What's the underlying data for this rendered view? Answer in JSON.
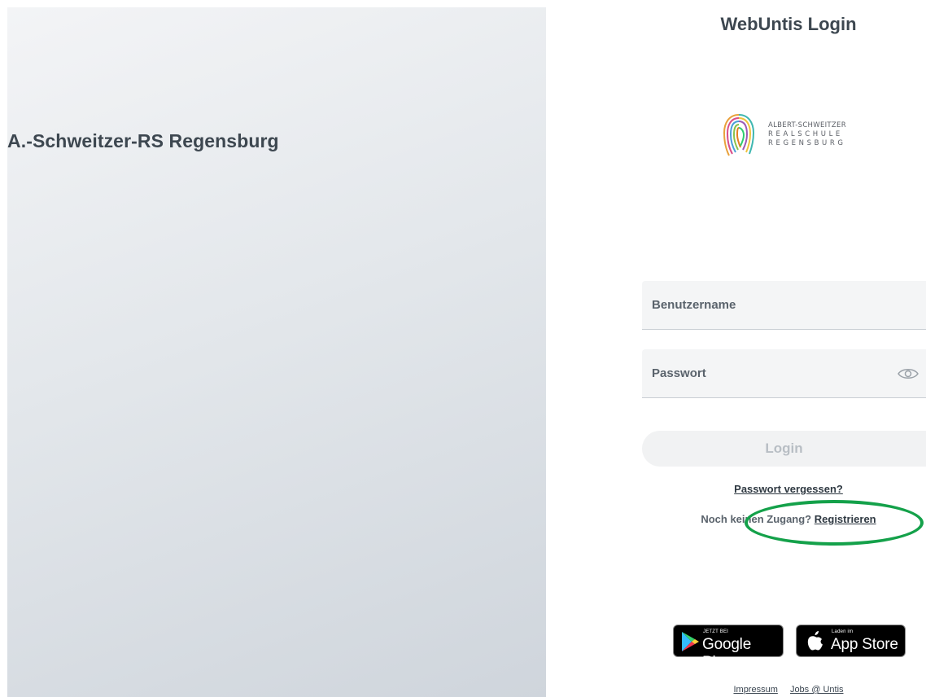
{
  "school": {
    "name": "A.-Schweitzer-RS Regensburg"
  },
  "login": {
    "title": "WebUntis Login",
    "logo_text": [
      "ALBERT-SCHWEITZER",
      "REALSCHULE",
      "REGENSBURG"
    ],
    "username_placeholder": "Benutzername",
    "password_placeholder": "Passwort",
    "login_button": "Login",
    "forgot_password": "Passwort vergessen?",
    "no_access_text": "Noch keinen Zugang?",
    "register_link": "Registrieren"
  },
  "stores": {
    "google_small": "JETZT BEI",
    "google_big": "Google Play",
    "apple_small": "Laden im",
    "apple_big": "App Store"
  },
  "footer": {
    "impressum": "Impressum",
    "jobs": "Jobs @ Untis"
  },
  "colors": {
    "highlight": "#14a14a",
    "accent_text": "#3d4750"
  },
  "icons": [
    "fingerprint-logo-icon",
    "eye-icon",
    "google-play-icon",
    "apple-icon"
  ]
}
